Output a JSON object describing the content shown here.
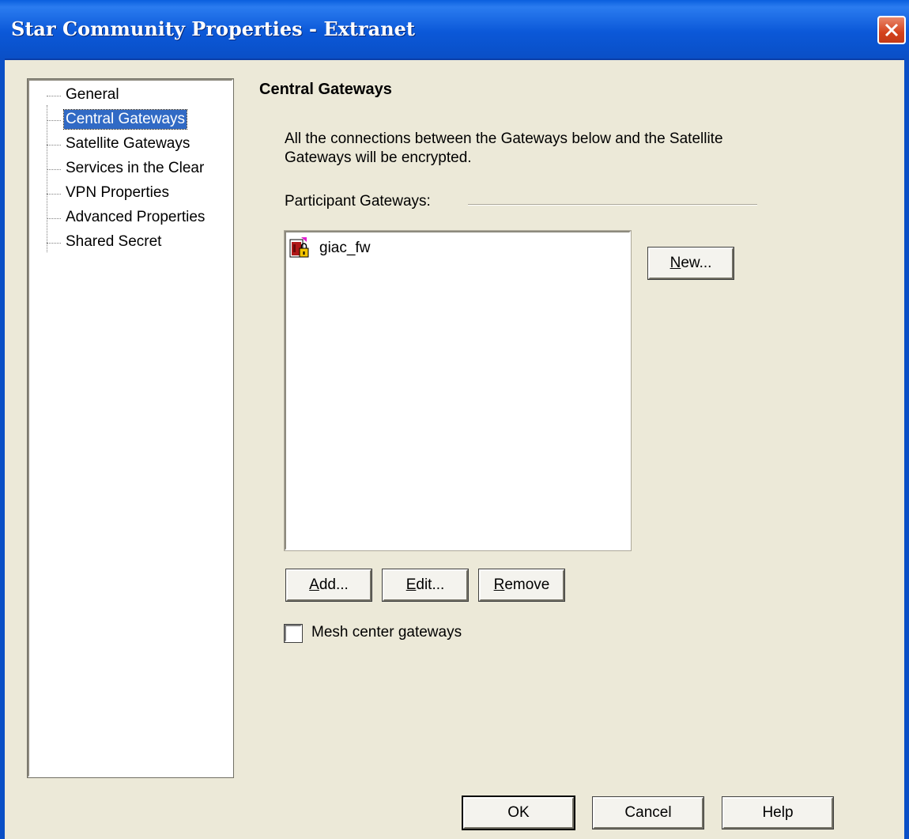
{
  "window": {
    "title": "Star Community Properties - Extranet"
  },
  "tree": {
    "items": [
      {
        "label": "General",
        "selected": false
      },
      {
        "label": "Central Gateways",
        "selected": true
      },
      {
        "label": "Satellite Gateways",
        "selected": false
      },
      {
        "label": "Services in the Clear",
        "selected": false
      },
      {
        "label": "VPN Properties",
        "selected": false
      },
      {
        "label": "Advanced Properties",
        "selected": false
      },
      {
        "label": "Shared Secret",
        "selected": false
      }
    ]
  },
  "panel": {
    "title": "Central Gateways",
    "description": "All the connections between the Gateways below and the Satellite Gateways will be encrypted.",
    "participants_label": "Participant Gateways:",
    "participants": [
      {
        "name": "giac_fw",
        "icon": "gateway-icon"
      }
    ],
    "new_button": {
      "underlined": "N",
      "rest": "ew..."
    },
    "add_button": {
      "underlined": "A",
      "rest": "dd..."
    },
    "edit_button": {
      "underlined": "E",
      "rest": "dit..."
    },
    "remove_button": {
      "underlined": "R",
      "rest": "emove"
    },
    "mesh_checkbox": {
      "label": "Mesh center gateways",
      "checked": false
    }
  },
  "footer": {
    "ok_label": "OK",
    "cancel_label": "Cancel",
    "help_label": "Help"
  },
  "colors": {
    "titlebar": "#0a58d8",
    "selection": "#316ac5",
    "dialog_bg": "#ece9d8"
  }
}
